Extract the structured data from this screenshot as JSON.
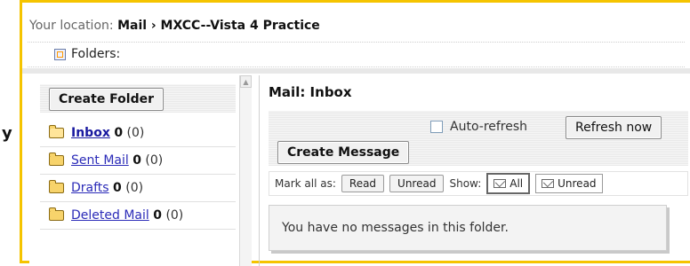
{
  "edge_glyph": "y",
  "location": {
    "prefix": "Your location:",
    "path": "Mail › MXCC--Vista 4 Practice"
  },
  "folders_label": "Folders:",
  "sidebar": {
    "create_folder_label": "Create Folder",
    "items": [
      {
        "name": "Inbox",
        "count": "0",
        "total": "(0)",
        "active": true
      },
      {
        "name": "Sent Mail",
        "count": "0",
        "total": "(0)",
        "active": false
      },
      {
        "name": "Drafts",
        "count": "0",
        "total": "(0)",
        "active": false
      },
      {
        "name": "Deleted Mail",
        "count": "0",
        "total": "(0)",
        "active": false
      }
    ]
  },
  "main": {
    "title": "Mail: Inbox",
    "auto_refresh_label": "Auto-refresh",
    "auto_refresh_checked": false,
    "refresh_now_label": "Refresh now",
    "create_message_label": "Create Message",
    "mark_all_label": "Mark all as:",
    "read_label": "Read",
    "unread_label": "Unread",
    "show_label": "Show:",
    "show_all_label": "All",
    "show_unread_label": "Unread",
    "empty_message": "You have no messages in this folder."
  },
  "colors": {
    "accent_border": "#f5c400",
    "link": "#2b2bb8"
  }
}
